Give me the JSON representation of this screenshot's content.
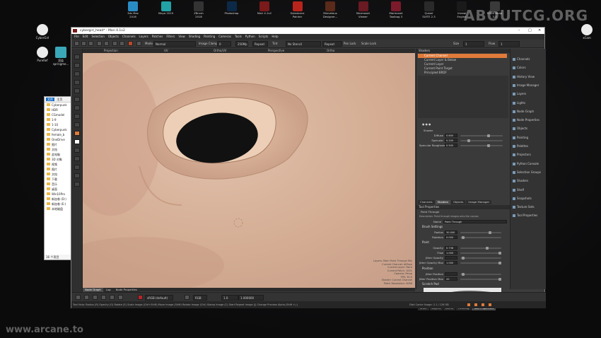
{
  "desktop": {
    "watermark": "ABOUTCG.ORG",
    "bottom_watermark": "www.arcane.to",
    "top_apps": [
      {
        "label": "3ds Max",
        "sub": "2016",
        "color": "#2a8cc4"
      },
      {
        "label": "Maya 2019",
        "sub": "",
        "color": "#22a2a7"
      },
      {
        "label": "ZBrush",
        "sub": "2018",
        "color": "#333333"
      },
      {
        "label": "Photoshop",
        "sub": "",
        "color": "#0c2a48"
      },
      {
        "label": "Mari 4.1v2",
        "sub": "",
        "color": "#7a1a1a"
      },
      {
        "label": "Substance",
        "sub": "Painter",
        "color": "#b8241c"
      },
      {
        "label": "Marvelous",
        "sub": "Designer...",
        "color": "#5a2a1a"
      },
      {
        "label": "Marmoset",
        "sub": "Viewer",
        "color": "#6a1a22"
      },
      {
        "label": "Marmoset",
        "sub": "Toolbag 3",
        "color": "#7a1a2a"
      },
      {
        "label": "Quixel",
        "sub": "SUITE 2.3",
        "color": "#2a2a2a"
      },
      {
        "label": "Unreal",
        "sub": "Engine",
        "color": "#1a1a1a"
      },
      {
        "label": "R3DS Wrap",
        "sub": "3.3",
        "color": "#3a3a3a"
      }
    ],
    "left_apps": [
      {
        "label": "CyberGirl",
        "color": "#ececec"
      },
      {
        "label": "PureRef",
        "color": "#ececec"
      },
      {
        "label": "渲染",
        "sub": "springme...",
        "color": "#3aa8b8"
      }
    ],
    "right_apps": [
      {
        "label": "xCam",
        "color": "#ececec"
      }
    ]
  },
  "explorer": {
    "tabs": [
      "文件",
      "主页"
    ],
    "items": [
      "Cyberpunk",
      "HDR",
      "CGmodel",
      "1-9",
      "1-10",
      "Cyberpunk",
      "female_b",
      "OneDrive",
      "图片",
      "文档",
      "此电脑",
      "3D 对象",
      "视频",
      "图片",
      "文档",
      "下载",
      "音乐",
      "桌面",
      "Win10Pro",
      "新加卷 (D:)",
      "新加卷 (E:)",
      "本地磁盘"
    ],
    "status": "16 个项目"
  },
  "mari": {
    "title": "cybergirl_head* - Mari 4.1v2",
    "window_buttons": [
      "–",
      "□",
      "✕"
    ],
    "menu": [
      "File",
      "Edit",
      "Selection",
      "Objects",
      "Channels",
      "Layers",
      "Patches",
      "Filters",
      "View",
      "Shading",
      "Painting",
      "Cameras",
      "Tools",
      "Python",
      "Scripts",
      "Help"
    ],
    "toolbar": {
      "mode_label": "Mode",
      "mode_value": "Normal",
      "clamp_label": "Image Clamp",
      "clamp_value": "0",
      "res_value": "256Mp",
      "repeat_value": "Repeat",
      "tint_label": "Tint",
      "stencil_value": "No Stencil",
      "image_value": "Repeat Image",
      "lock1": "Pan Lock",
      "lock2": "Scale Lock",
      "size_label": "Size",
      "size_value": "1",
      "flow_label": "Flow",
      "flow_value": "1"
    },
    "view_labels": [
      "Projection",
      "UV",
      "Ortho/UV",
      "Perspective",
      "Ortho"
    ],
    "viewport_text": [
      "Layers: Main Paint Through Mix",
      "Current Channel: diffuse",
      "Current Layer: Paint",
      "Current Patch: 1001",
      "Camera: Persp",
      "FPS: 30.0",
      "Shader: Current Channel",
      "Patch Resolution: 4096"
    ],
    "channels_panel": {
      "items": [
        "Current Channel",
        "Current Layer & Below",
        "Current Layer",
        "Current Paint Target",
        "Principled BRDF"
      ],
      "shader_label": "Shader",
      "props": [
        {
          "label": "Diffuse",
          "value": "0.600"
        },
        {
          "label": "Specular",
          "value": "0.200"
        },
        {
          "label": "Specular Roughness",
          "value": "0.500"
        }
      ],
      "tabs": [
        "Channels",
        "Shaders",
        "Objects",
        "Image Manager"
      ]
    },
    "tool_properties": {
      "header": "Tool Properties",
      "tool_name": "Paint Through",
      "description": "Description: Paint through images onto the canvas",
      "name_label": "Name",
      "name_value": "Paint Through",
      "sections": [
        "Brush Settings",
        "Paint",
        "Position",
        "Scratch Pad"
      ],
      "brush": [
        {
          "label": "Radius",
          "value": "30.000"
        },
        {
          "label": "Rotation",
          "value": "0.000"
        }
      ],
      "paint": [
        {
          "label": "Opacity",
          "value": "0.738"
        },
        {
          "label": "Flow",
          "value": "1.000"
        },
        {
          "label": "Jitter Opacity",
          "value": ""
        },
        {
          "label": "Jitter Opacity Max",
          "value": "1.000"
        }
      ],
      "position": [
        {
          "label": "Jitter Position",
          "value": ""
        },
        {
          "label": "Jitter Position Max",
          "value": "20"
        }
      ],
      "tabs": [
        "Shelf",
        "Layers",
        "Affine",
        "Painting",
        "Tool Properties"
      ]
    },
    "shelf": [
      "Channels",
      "Colors",
      "History View",
      "Image Manager",
      "Layers",
      "Lights",
      "Node Graph",
      "Node Properties",
      "Objects",
      "Painting",
      "Palettes",
      "Projectors",
      "Python Console",
      "Selection Groups",
      "Shaders",
      "Shelf",
      "Snapshots",
      "Texture Sets",
      "Tool Properties"
    ],
    "bottom_tabs": [
      "Node Graph",
      "Log",
      "Node Properties"
    ],
    "bottom_toolbar": {
      "colorspace": "sRGB (default)",
      "view_value": "RGB",
      "gamma_value": "1.0",
      "exposure_value": "1.000000"
    },
    "status": "Tool Help:  Radius (R)  Opacity (O)  Rotate (E)  Scale Image (Ctrl+Shift)  Move Image (Shift)  Rotate Image (Ctrl)  Stamp Image (C)  Start Repeat Image (J)  Change Preview Alpha (Shift +/-)",
    "status_right": "Disk Cache Usage: 2.1 / 128 GB",
    "colors": {
      "skin": "#d6b198",
      "accent": "#e07a3a"
    }
  }
}
